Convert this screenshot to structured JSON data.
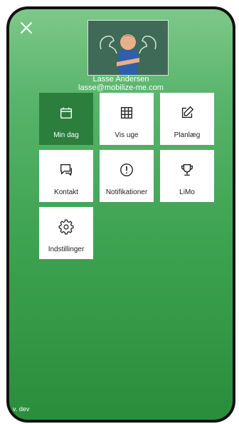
{
  "user": {
    "name": "Lasse Andersen",
    "email": "lasse@mobilize-me.com"
  },
  "menu": [
    {
      "label": "Min dag",
      "icon": "calendar-icon"
    },
    {
      "label": "Vis uge",
      "icon": "grid-icon"
    },
    {
      "label": "Planlæg",
      "icon": "edit-icon"
    },
    {
      "label": "Kontakt",
      "icon": "chat-icon"
    },
    {
      "label": "Notifikationer",
      "icon": "alert-icon"
    },
    {
      "label": "LiMo",
      "icon": "trophy-icon"
    },
    {
      "label": "Indstillinger",
      "icon": "gear-icon"
    }
  ],
  "footer": {
    "version": "v. dev"
  },
  "colors": {
    "active_tile": "#2b7e3c",
    "background_top": "#7ec889",
    "background_bottom": "#2a8d3b"
  }
}
